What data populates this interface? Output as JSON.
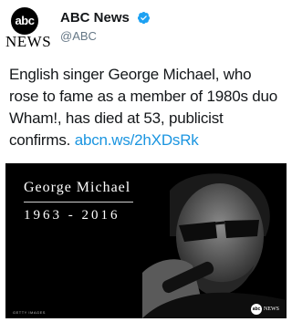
{
  "account": {
    "avatar_logo": "abc",
    "avatar_wordmark": "NEWS",
    "display_name": "ABC News",
    "handle": "@ABC",
    "verified_icon": "verified-badge-icon"
  },
  "tweet": {
    "text": "English singer George Michael, who rose to fame as a member of 1980s duo Wham!, has died at 53, publicist confirms.",
    "link": "abcn.ws/2hXDsRk"
  },
  "media": {
    "caption_name": "George Michael",
    "caption_years": "1963 - 2016",
    "credit": "GETTY IMAGES",
    "logo_mark": "abc",
    "logo_text": "NEWS"
  },
  "colors": {
    "link": "#1b95e0",
    "verified": "#1da1f2",
    "text": "#14171a",
    "handle": "#657786"
  }
}
